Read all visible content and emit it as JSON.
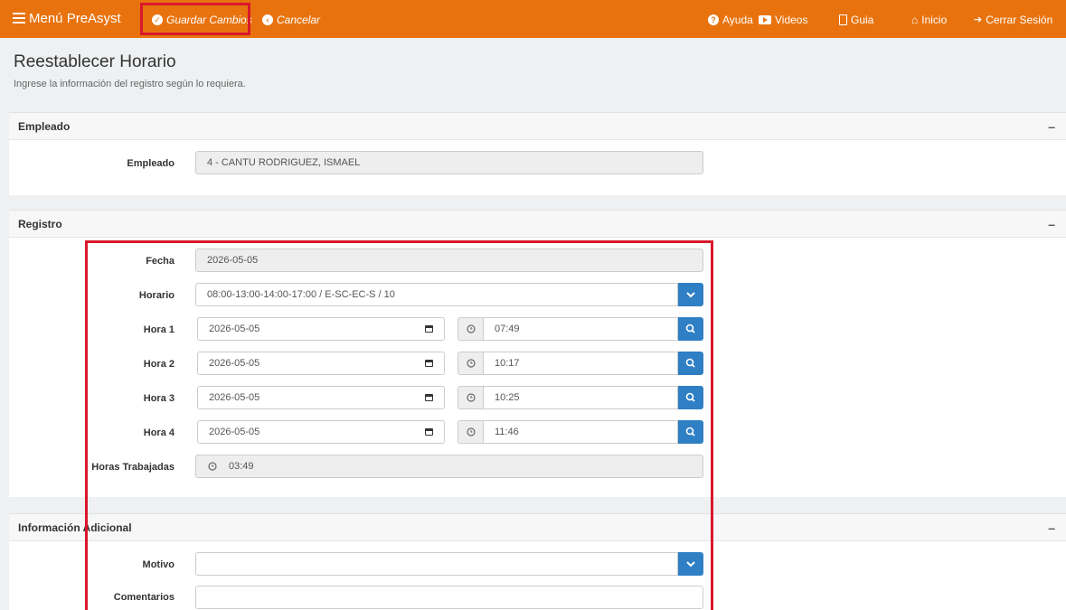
{
  "topbar": {
    "menu_label": "Menú PreAsyst",
    "save_label": "Guardar Cambios",
    "cancel_label": "Cancelar",
    "help_label": "Ayuda",
    "videos_label": "Videos",
    "guide_label": "Guia",
    "home_label": "Inicio",
    "logout_label": "Cerrar Sesión"
  },
  "page": {
    "title": "Reestablecer Horario",
    "subtitle": "Ingrese la información del registro según lo requiera."
  },
  "empleado_panel": {
    "header": "Empleado",
    "collapse": "–",
    "label": "Empleado",
    "value": "4 - CANTU RODRIGUEZ, ISMAEL"
  },
  "registro_panel": {
    "header": "Registro",
    "collapse": "–",
    "fecha_label": "Fecha",
    "fecha_value": "2026-05-05",
    "horario_label": "Horario",
    "horario_value": "08:00-13:00-14:00-17:00 / E-SC-EC-S / 10",
    "horas": [
      {
        "label": "Hora 1",
        "date": "2026-05-05",
        "time": "07:49"
      },
      {
        "label": "Hora 2",
        "date": "2026-05-05",
        "time": "10:17"
      },
      {
        "label": "Hora 3",
        "date": "2026-05-05",
        "time": "10:25"
      },
      {
        "label": "Hora 4",
        "date": "2026-05-05",
        "time": "11:46"
      }
    ],
    "trabajadas_label": "Horas Trabajadas",
    "trabajadas_value": "03:49"
  },
  "info_panel": {
    "header": "Información Adicional",
    "collapse": "–",
    "motivo_label": "Motivo",
    "motivo_value": "",
    "comentarios_label": "Comentarios",
    "comentarios_value": ""
  },
  "colors": {
    "topbar": "#e8730e",
    "button_blue": "#2f7fc4",
    "highlight_red": "#d9182b"
  },
  "icons": {
    "menu": "hamburger-icon",
    "save": "check-circle-icon",
    "cancel": "arrow-left-circle-icon",
    "help": "question-circle-icon",
    "videos": "video-icon",
    "guide": "file-icon",
    "home": "home-icon",
    "logout": "sign-out-icon",
    "dropdown": "chevron-down-icon",
    "search": "search-icon",
    "calendar": "calendar-icon",
    "clock": "clock-icon"
  }
}
